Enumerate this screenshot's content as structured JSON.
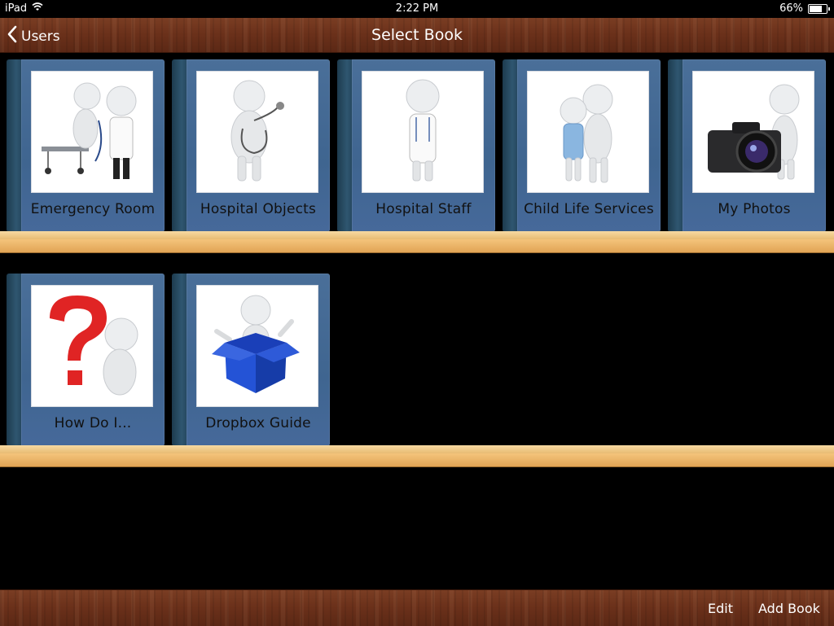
{
  "status": {
    "device": "iPad",
    "time": "2:22 PM",
    "battery": "66%",
    "battery_level": 0.66
  },
  "nav": {
    "back_label": "Users",
    "title": "Select Book"
  },
  "books": [
    {
      "title": "Emergency Room",
      "icon": "emergency-room-illustration"
    },
    {
      "title": "Hospital Objects",
      "icon": "stethoscope-person-illustration"
    },
    {
      "title": "Hospital Staff",
      "icon": "doctor-illustration"
    },
    {
      "title": "Child Life Services",
      "icon": "adult-child-illustration"
    },
    {
      "title": "My Photos",
      "icon": "camera-illustration"
    },
    {
      "title": "How Do I...",
      "icon": "question-mark-illustration"
    },
    {
      "title": "Dropbox Guide",
      "icon": "blue-box-illustration"
    }
  ],
  "toolbar": {
    "edit_label": "Edit",
    "add_label": "Add Book"
  },
  "colors": {
    "wood": "#6a301a",
    "cover": "#46699a",
    "spine": "#2f5670",
    "shelf": "#f4c47b"
  }
}
